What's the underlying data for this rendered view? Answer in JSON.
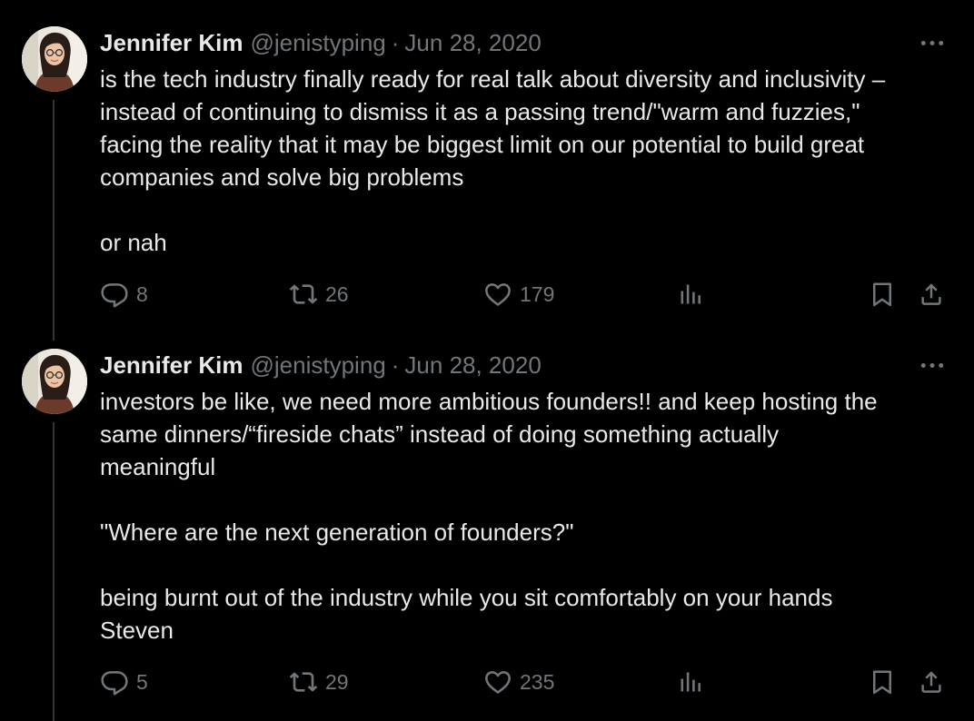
{
  "colors": {
    "background": "#000000",
    "text_primary": "#e7e9ea",
    "text_secondary": "#71767b",
    "thread_line": "#333639"
  },
  "tweets": [
    {
      "author": {
        "name": "Jennifer Kim",
        "handle": "@jenistyping"
      },
      "separator": "·",
      "date": "Jun 28, 2020",
      "text": "is the tech industry finally ready for real talk about diversity and inclusivity –\ninstead of continuing to dismiss it as a passing trend/\"warm and fuzzies,\"\nfacing the reality that it may be biggest limit on our potential to build great\ncompanies and solve big problems\n\nor nah",
      "stats": {
        "replies": "8",
        "retweets": "26",
        "likes": "179"
      },
      "icons": [
        "reply-icon",
        "retweet-icon",
        "like-icon",
        "views-icon",
        "bookmark-icon",
        "share-icon",
        "more-icon"
      ]
    },
    {
      "author": {
        "name": "Jennifer Kim",
        "handle": "@jenistyping"
      },
      "separator": "·",
      "date": "Jun 28, 2020",
      "text": "investors be like, we need more ambitious founders!! and keep hosting the\nsame dinners/“fireside chats” instead of doing something actually\nmeaningful\n\n\"Where are the next generation of founders?\"\n\nbeing burnt out of the industry while you sit comfortably on your hands\nSteven",
      "stats": {
        "replies": "5",
        "retweets": "29",
        "likes": "235"
      },
      "icons": [
        "reply-icon",
        "retweet-icon",
        "like-icon",
        "views-icon",
        "bookmark-icon",
        "share-icon",
        "more-icon"
      ]
    }
  ]
}
